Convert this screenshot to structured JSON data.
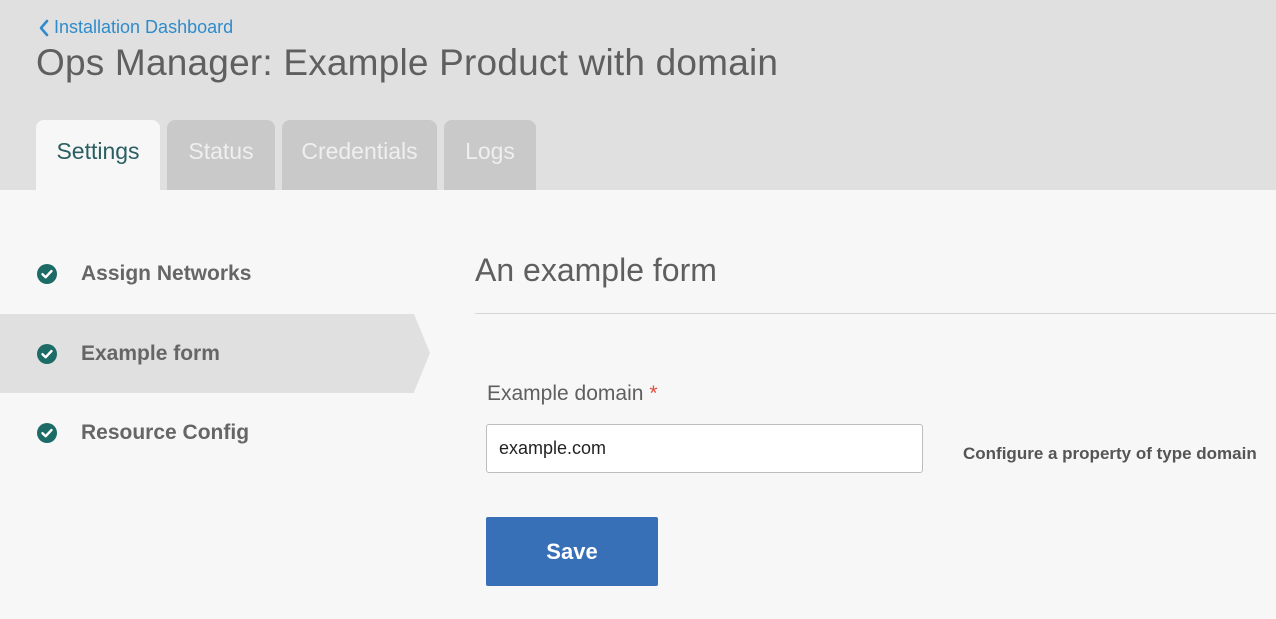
{
  "header": {
    "back_link": "Installation Dashboard",
    "title": "Ops Manager: Example Product with domain"
  },
  "tabs": [
    {
      "label": "Settings",
      "active": true
    },
    {
      "label": "Status",
      "active": false
    },
    {
      "label": "Credentials",
      "active": false
    },
    {
      "label": "Logs",
      "active": false
    }
  ],
  "sidebar": {
    "items": [
      {
        "label": "Assign Networks",
        "status_icon": "check-circle-icon",
        "active": false
      },
      {
        "label": "Example form",
        "status_icon": "check-circle-icon",
        "active": true
      },
      {
        "label": "Resource Config",
        "status_icon": "check-circle-icon",
        "active": false
      }
    ]
  },
  "form": {
    "title": "An example form",
    "field_label": "Example domain",
    "required_marker": "*",
    "field_value": "example.com",
    "help_text": "Configure a property of type domain",
    "save_label": "Save"
  },
  "colors": {
    "accent_blue": "#3870b7",
    "link_blue": "#2f8bcc",
    "check_green": "#1d6b66",
    "required_red": "#e24d3c"
  }
}
